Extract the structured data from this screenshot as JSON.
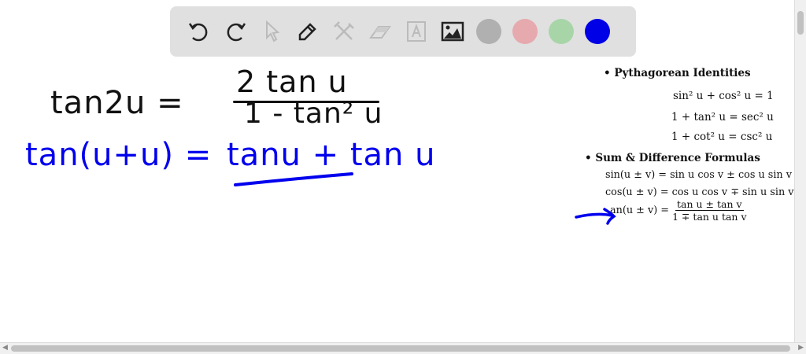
{
  "toolbar": {
    "tools": [
      "undo-icon",
      "redo-icon",
      "select-icon",
      "pen-icon",
      "tools-icon",
      "eraser-icon",
      "text-icon",
      "image-icon"
    ],
    "colors": [
      "#b0b0b0",
      "#e6a9ad",
      "#a8d5a8",
      "#0000e6"
    ]
  },
  "handwriting": {
    "line1_lhs": "tan2u =",
    "line1_num": "2 tan u",
    "line1_den": "1 - tan² u",
    "line2_lhs": "tan(u+u) =",
    "line2_rhs": "tanu + tan u",
    "ink_black": "#111111",
    "ink_blue": "#0000ee"
  },
  "reference": {
    "pyth_heading": "Pythagorean Identities",
    "pyth": [
      "sin² u + cos² u = 1",
      "1 + tan² u = sec² u",
      "1 + cot² u = csc² u"
    ],
    "sum_heading": "Sum & Difference Formulas",
    "sin_sum": "sin(u ± v) = sin u cos v ± cos u sin v",
    "cos_sum": "cos(u ± v) = cos u cos v ∓ sin u sin v",
    "tan_lhs": "an(u ± v) =",
    "tan_num": "tan u ± tan v",
    "tan_den": "1 ∓ tan u tan v"
  }
}
